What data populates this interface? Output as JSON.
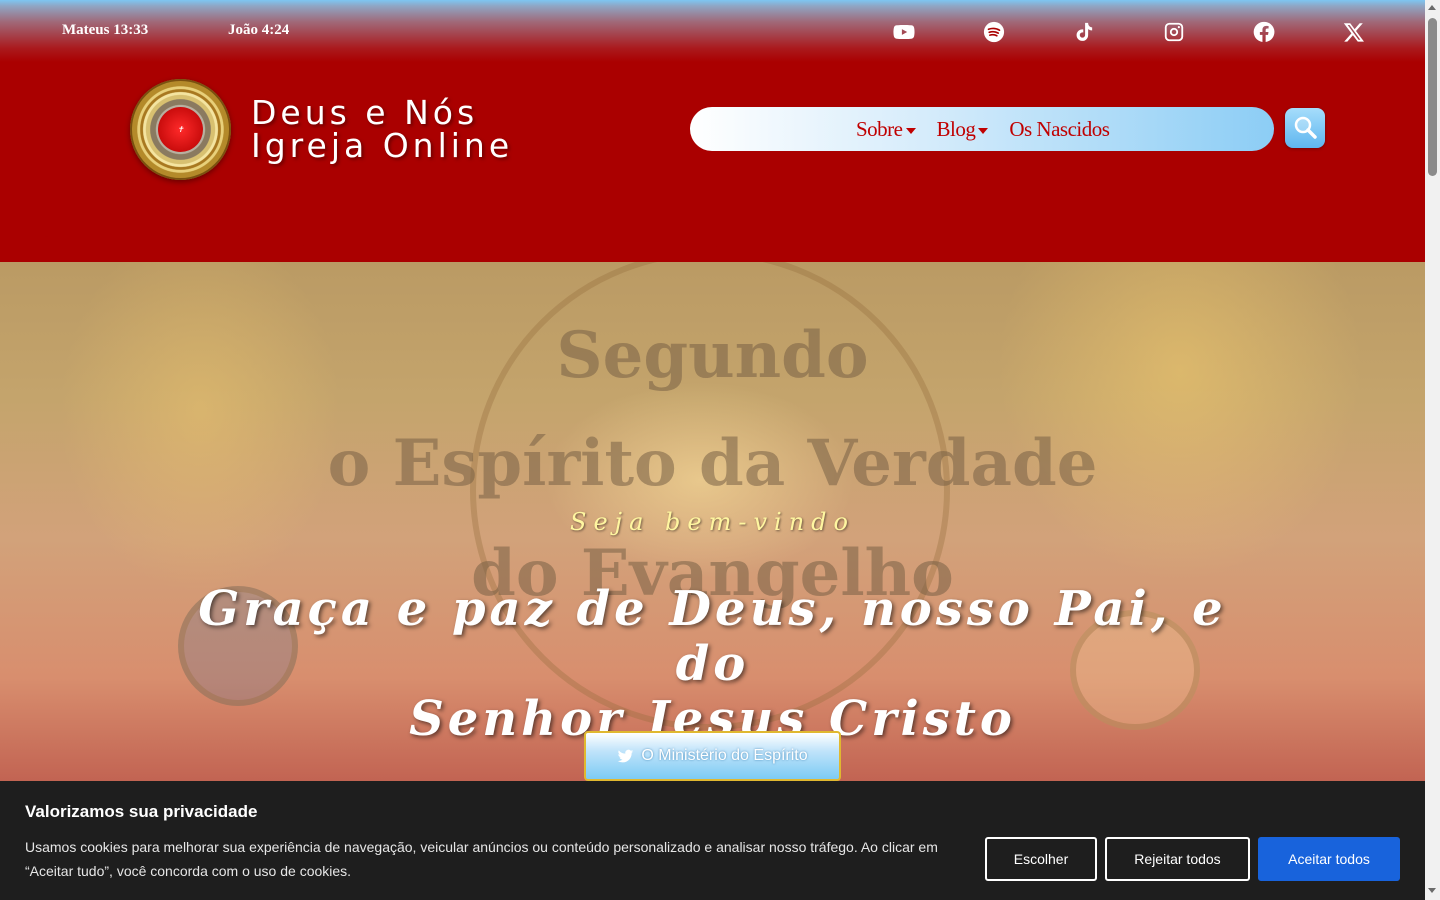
{
  "topbar": {
    "verses": [
      "Mateus 13:33",
      "João 4:24"
    ],
    "social_icons": [
      "youtube-icon",
      "spotify-icon",
      "tiktok-icon",
      "instagram-icon",
      "facebook-icon",
      "x-icon"
    ]
  },
  "header": {
    "brand_line1": "Deus e Nós",
    "brand_line2": "Igreja Online",
    "nav": [
      {
        "label": "Sobre",
        "dropdown": true
      },
      {
        "label": "Blog",
        "dropdown": true
      },
      {
        "label": "Os Nascidos",
        "dropdown": false
      }
    ],
    "search_icon": "magnifier-icon",
    "colors": {
      "header_red": "#aa0000",
      "nav_text": "#c00000"
    }
  },
  "hero": {
    "watermark": [
      "Segundo",
      "o Espírito da Verdade",
      "do Evangelho"
    ],
    "welcome": "Seja bem-vindo",
    "headline_line1": "Graça e paz de Deus, nosso Pai, e do",
    "headline_line2": "Senhor Jesus Cristo",
    "cta_label": "O Ministério do Espírito",
    "cta_icon": "dove-icon"
  },
  "cookie": {
    "title": "Valorizamos sua privacidade",
    "text": "Usamos cookies para melhorar sua experiência de navegação, veicular anúncios ou conteúdo personalizado e analisar nosso tráfego. Ao clicar em “Aceitar tudo”, você concorda com o uso de cookies.",
    "choose_label": "Escolher",
    "reject_label": "Rejeitar todos",
    "accept_label": "Aceitar todos",
    "accent": "#1863dc"
  }
}
